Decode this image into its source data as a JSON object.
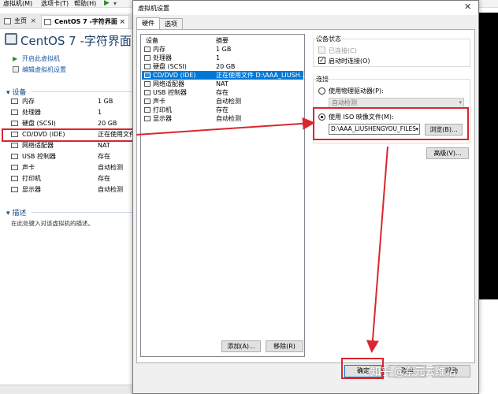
{
  "menubar": {
    "items": [
      "虚拟机(M)",
      "选项卡(T)",
      "帮助(H)"
    ]
  },
  "tabs": {
    "home": "主页",
    "vm": "CentOS 7 -字符界面"
  },
  "vm": {
    "title": "CentOS 7 -字符界面",
    "power_on": "开启此虚拟机",
    "edit_settings": "编辑虚拟机设置"
  },
  "devices": {
    "heading": "设备",
    "rows": [
      {
        "name": "内存",
        "value": "1 GB",
        "icon": "memory-icon"
      },
      {
        "name": "处理器",
        "value": "1",
        "icon": "cpu-icon"
      },
      {
        "name": "硬盘 (SCSI)",
        "value": "20 GB",
        "icon": "disk-icon"
      },
      {
        "name": "CD/DVD (IDE)",
        "value": "正在使用文件",
        "icon": "cd-icon"
      },
      {
        "name": "网络适配器",
        "value": "NAT",
        "icon": "network-icon"
      },
      {
        "name": "USB 控制器",
        "value": "存在",
        "icon": "usb-icon"
      },
      {
        "name": "声卡",
        "value": "自动检测",
        "icon": "sound-icon"
      },
      {
        "name": "打印机",
        "value": "存在",
        "icon": "printer-icon"
      },
      {
        "name": "显示器",
        "value": "自动检测",
        "icon": "monitor-icon"
      }
    ]
  },
  "description": {
    "heading": "描述",
    "placeholder": "在此处键入对该虚拟机的描述。"
  },
  "dialog": {
    "title": "虚拟机设置",
    "tab_hardware": "硬件",
    "tab_options": "选项",
    "col_device": "设备",
    "col_summary": "摘要",
    "hardware": [
      {
        "name": "内存",
        "summary": "1 GB"
      },
      {
        "name": "处理器",
        "summary": "1"
      },
      {
        "name": "硬盘 (SCSI)",
        "summary": "20 GB"
      },
      {
        "name": "CD/DVD (IDE)",
        "summary": "正在使用文件 D:\\AAA_LIUSH..."
      },
      {
        "name": "网络适配器",
        "summary": "NAT"
      },
      {
        "name": "USB 控制器",
        "summary": "存在"
      },
      {
        "name": "声卡",
        "summary": "自动检测"
      },
      {
        "name": "打印机",
        "summary": "存在"
      },
      {
        "name": "显示器",
        "summary": "自动检测"
      }
    ],
    "add_button": "添加(A)...",
    "remove_button": "移除(R)",
    "device_status": {
      "label": "设备状态",
      "connected": "已连接(C)",
      "connect_at_power_on": "启动时连接(O)"
    },
    "connection": {
      "label": "连接",
      "physical_drive": "使用物理驱动器(P):",
      "physical_drive_value": "自动检测",
      "iso_image": "使用 ISO 映像文件(M):",
      "iso_path": "D:\\AAA_LIUSHENGYOU_FILES",
      "browse_button": "浏览(B)..."
    },
    "advanced_button": "高级(V)...",
    "footer_buttons": [
      "确定",
      "取消",
      "帮助"
    ]
  },
  "watermark": "知乎 @奈元云维站",
  "colors": {
    "annotation_red": "#d9272e",
    "selection_blue": "#0078d7",
    "link_blue": "#1c59a4"
  }
}
